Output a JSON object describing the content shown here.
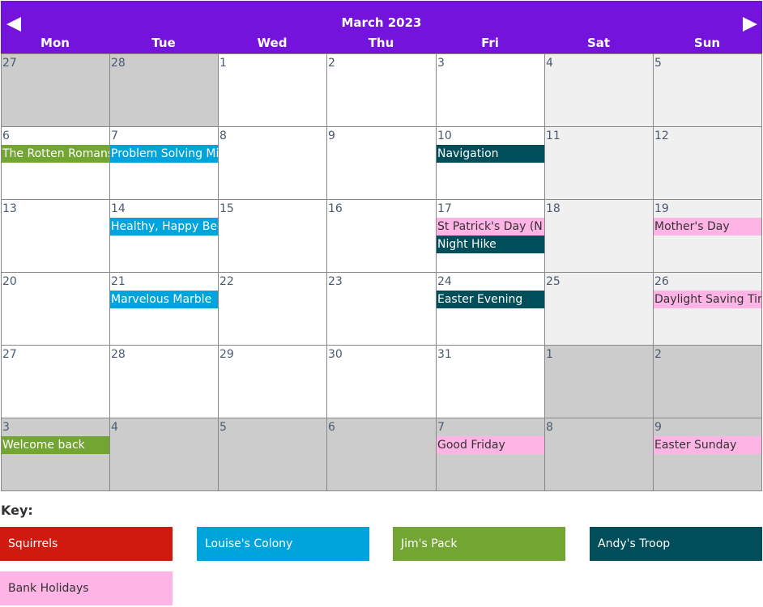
{
  "header": {
    "title": "March 2023",
    "prev_icon": "triangle-left-icon",
    "next_icon": "triangle-right-icon",
    "days": [
      "Mon",
      "Tue",
      "Wed",
      "Thu",
      "Fri",
      "Sat",
      "Sun"
    ]
  },
  "groups": {
    "squirrels": {
      "label": "Squirrels",
      "color": "#d0190f",
      "text": "#ffffff"
    },
    "louise": {
      "label": "Louise's Colony",
      "color": "#00a4dc",
      "text": "#ffffff"
    },
    "jim": {
      "label": "Jim's Pack",
      "color": "#73a532",
      "text": "#ffffff"
    },
    "andy": {
      "label": "Andy's Troop",
      "color": "#004e5a",
      "text": "#ffffff"
    },
    "bank": {
      "label": "Bank Holidays",
      "color": "#ffb4e6",
      "text": "#333333"
    }
  },
  "key_title": "Key:",
  "key_order": [
    "squirrels",
    "louise",
    "jim",
    "andy",
    "bank"
  ],
  "weeks": [
    [
      {
        "n": "27",
        "t": "other"
      },
      {
        "n": "28",
        "t": "other"
      },
      {
        "n": "1",
        "t": "cur"
      },
      {
        "n": "2",
        "t": "cur"
      },
      {
        "n": "3",
        "t": "cur"
      },
      {
        "n": "4",
        "t": "weekend"
      },
      {
        "n": "5",
        "t": "weekend"
      }
    ],
    [
      {
        "n": "6",
        "t": "cur",
        "ev": [
          {
            "title": "The Rotten Romans",
            "g": "jim"
          }
        ]
      },
      {
        "n": "7",
        "t": "cur",
        "ev": [
          {
            "title": "Problem Solving Mission",
            "g": "louise"
          }
        ]
      },
      {
        "n": "8",
        "t": "cur"
      },
      {
        "n": "9",
        "t": "cur"
      },
      {
        "n": "10",
        "t": "cur",
        "ev": [
          {
            "title": "Navigation",
            "g": "andy"
          }
        ]
      },
      {
        "n": "11",
        "t": "weekend"
      },
      {
        "n": "12",
        "t": "weekend"
      }
    ],
    [
      {
        "n": "13",
        "t": "cur"
      },
      {
        "n": "14",
        "t": "cur",
        "ev": [
          {
            "title": "Healthy, Happy Bees",
            "g": "louise"
          }
        ]
      },
      {
        "n": "15",
        "t": "cur"
      },
      {
        "n": "16",
        "t": "cur"
      },
      {
        "n": "17",
        "t": "cur",
        "ev": [
          {
            "title": "St Patrick's Day (N",
            "g": "bank"
          },
          {
            "title": "Night Hike",
            "g": "andy"
          }
        ]
      },
      {
        "n": "18",
        "t": "weekend"
      },
      {
        "n": "19",
        "t": "weekend",
        "ev": [
          {
            "title": "Mother's Day",
            "g": "bank"
          }
        ]
      }
    ],
    [
      {
        "n": "20",
        "t": "cur"
      },
      {
        "n": "21",
        "t": "cur",
        "ev": [
          {
            "title": "Marvelous Marble",
            "g": "louise"
          }
        ]
      },
      {
        "n": "22",
        "t": "cur"
      },
      {
        "n": "23",
        "t": "cur"
      },
      {
        "n": "24",
        "t": "cur",
        "ev": [
          {
            "title": "Easter Evening",
            "g": "andy"
          }
        ]
      },
      {
        "n": "25",
        "t": "weekend"
      },
      {
        "n": "26",
        "t": "weekend",
        "ev": [
          {
            "title": "Daylight Saving Time",
            "g": "bank"
          }
        ]
      }
    ],
    [
      {
        "n": "27",
        "t": "cur"
      },
      {
        "n": "28",
        "t": "cur"
      },
      {
        "n": "29",
        "t": "cur"
      },
      {
        "n": "30",
        "t": "cur"
      },
      {
        "n": "31",
        "t": "cur"
      },
      {
        "n": "1",
        "t": "other"
      },
      {
        "n": "2",
        "t": "other"
      }
    ],
    [
      {
        "n": "3",
        "t": "other",
        "ev": [
          {
            "title": "Welcome back",
            "g": "jim"
          }
        ]
      },
      {
        "n": "4",
        "t": "other"
      },
      {
        "n": "5",
        "t": "other"
      },
      {
        "n": "6",
        "t": "other"
      },
      {
        "n": "7",
        "t": "other",
        "ev": [
          {
            "title": "Good Friday",
            "g": "bank"
          }
        ]
      },
      {
        "n": "8",
        "t": "other"
      },
      {
        "n": "9",
        "t": "other",
        "ev": [
          {
            "title": "Easter Sunday",
            "g": "bank"
          }
        ]
      }
    ]
  ]
}
